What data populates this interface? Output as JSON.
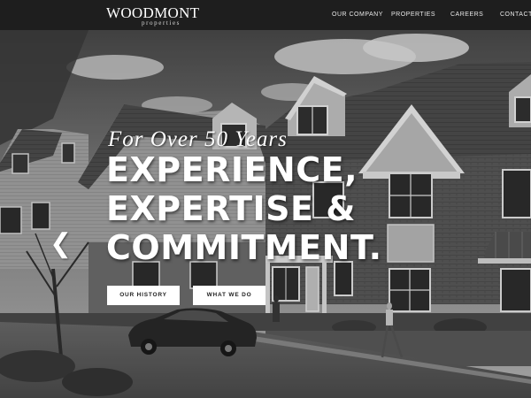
{
  "brand": {
    "name": "WOODMONT",
    "sub": "properties"
  },
  "nav": [
    "OUR COMPANY",
    "PROPERTIES",
    "CAREERS",
    "CONTACT US"
  ],
  "hero": {
    "tagline": "For Over 50 Years",
    "headline": [
      "EXPERIENCE,",
      "EXPERTISE &",
      "COMMITMENT."
    ],
    "buttons": {
      "history": "OUR HISTORY",
      "what": "WHAT WE DO"
    },
    "prev_icon": "chevron-left-icon"
  },
  "colors": {
    "header_bg": "#1e1e1e",
    "text": "#ffffff",
    "button_bg": "#ffffff",
    "button_text": "#222222"
  }
}
